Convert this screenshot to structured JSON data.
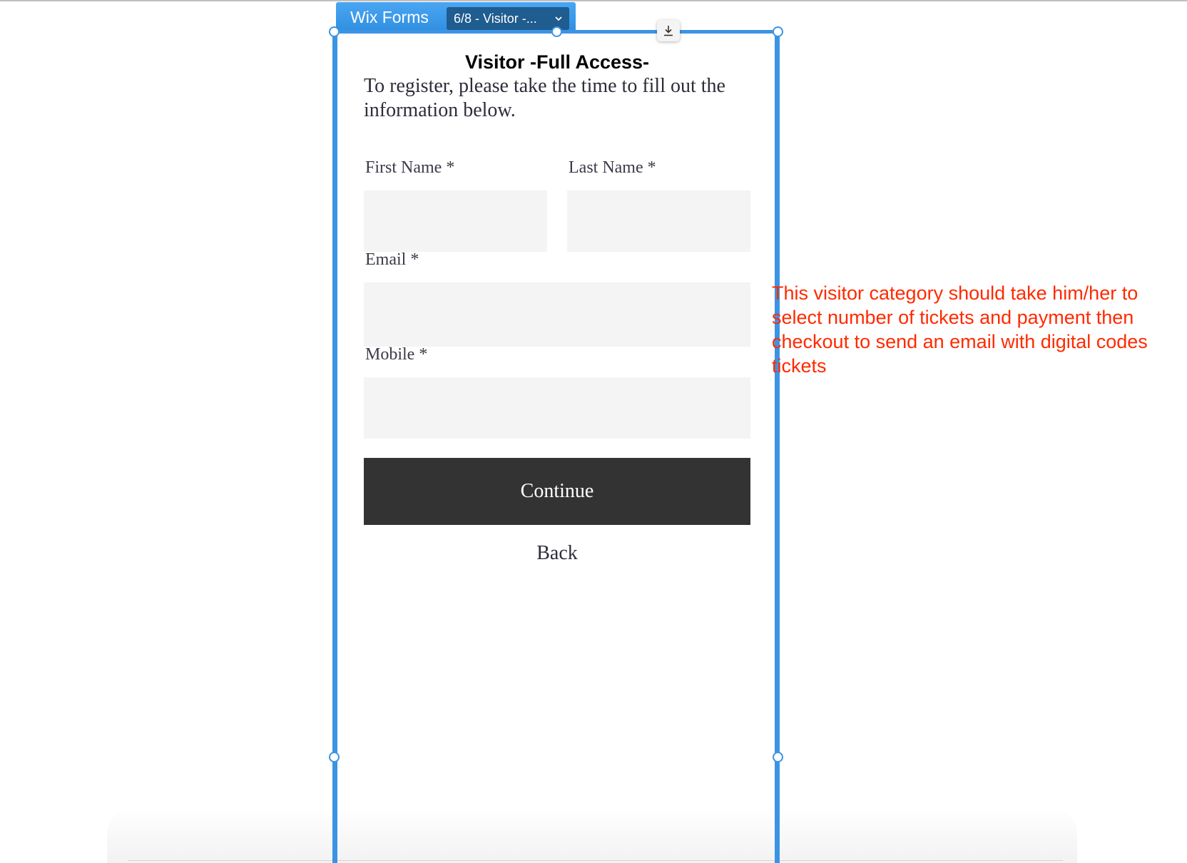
{
  "editor": {
    "tag_label": "Wix Forms",
    "dropdown_value": "6/8 - Visitor -...",
    "dropdown_chevron": "⌄",
    "accent_color": "#3b94e3"
  },
  "form": {
    "title": "Visitor -Full Access-",
    "description": "To register, please take the time to fill out the information below.",
    "fields": {
      "first_name": {
        "label": "First Name *",
        "value": ""
      },
      "last_name": {
        "label": "Last Name *",
        "value": ""
      },
      "email": {
        "label": "Email *",
        "value": ""
      },
      "mobile": {
        "label": "Mobile *",
        "value": ""
      }
    },
    "continue_label": "Continue",
    "back_label": "Back",
    "button_color": "#333333",
    "input_bg_color": "#f4f4f4"
  },
  "annotation": {
    "text": "This visitor category should take him/her to select number of tickets and payment then checkout to send an email with digital codes tickets",
    "color": "#ff2a00"
  },
  "icons": {
    "download": "download-icon",
    "chevron": "chevron-down-icon"
  }
}
